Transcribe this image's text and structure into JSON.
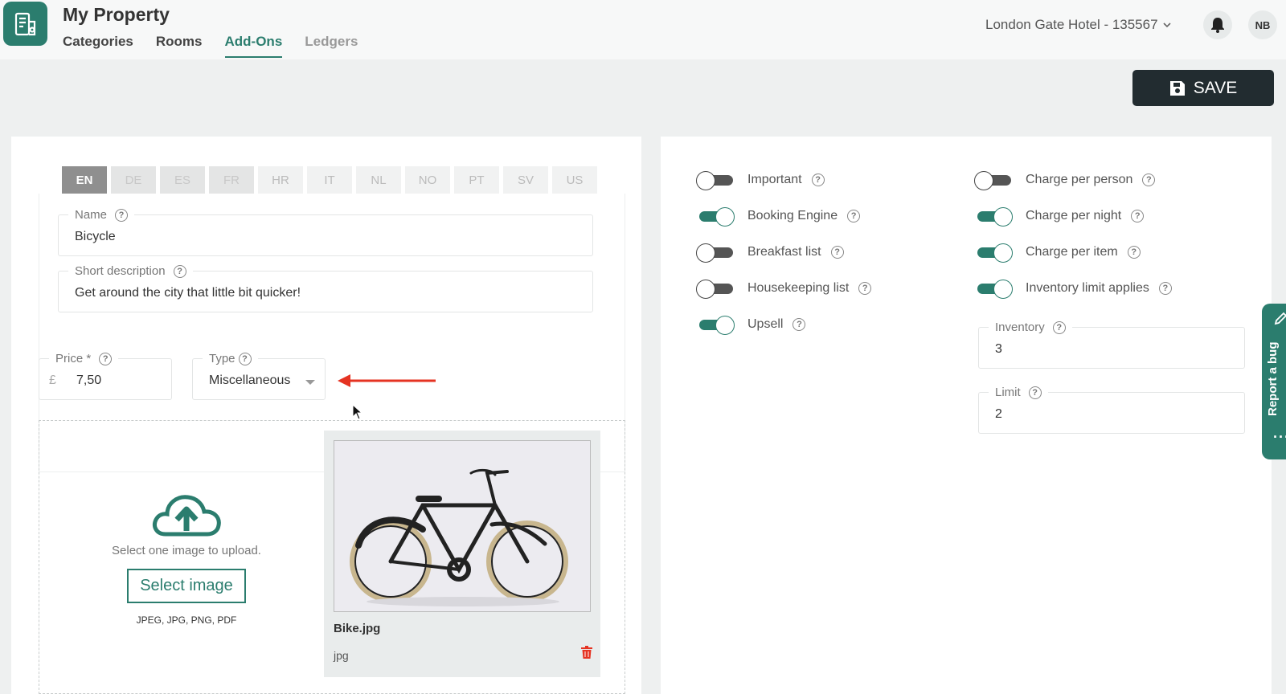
{
  "header": {
    "title": "My Property",
    "nav": [
      "Categories",
      "Rooms",
      "Add-Ons",
      "Ledgers"
    ],
    "hotel": "London Gate Hotel - 135567",
    "user_initials": "NB"
  },
  "toolbar": {
    "save_label": "SAVE"
  },
  "languages": [
    "EN",
    "DE",
    "ES",
    "FR",
    "HR",
    "IT",
    "NL",
    "NO",
    "PT",
    "SV",
    "US"
  ],
  "form": {
    "name_label": "Name",
    "name_value": "Bicycle",
    "short_desc_label": "Short description",
    "short_desc_value": "Get around the city that little bit quicker!",
    "price_label": "Price *",
    "currency": "£",
    "price_value": "7,50",
    "type_label": "Type",
    "type_value": "Miscellaneous"
  },
  "upload": {
    "prompt": "Select one image to upload.",
    "button": "Select image",
    "formats": "JPEG, JPG, PNG, PDF",
    "file_name": "Bike.jpg",
    "file_type": "jpg"
  },
  "toggles_left": [
    {
      "label": "Important",
      "on": false
    },
    {
      "label": "Booking Engine",
      "on": true
    },
    {
      "label": "Breakfast list",
      "on": false
    },
    {
      "label": "Housekeeping list",
      "on": false
    },
    {
      "label": "Upsell",
      "on": true
    }
  ],
  "toggles_right": [
    {
      "label": "Charge per person",
      "on": false
    },
    {
      "label": "Charge per night",
      "on": true
    },
    {
      "label": "Charge per item",
      "on": true
    },
    {
      "label": "Inventory limit applies",
      "on": true
    }
  ],
  "inventory": {
    "label": "Inventory",
    "value": "3"
  },
  "limit": {
    "label": "Limit",
    "value": "2"
  },
  "report": {
    "label": "Report a bug"
  },
  "colors": {
    "accent": "#2b7d6e",
    "dark": "#222c30",
    "arrow": "#e53322"
  }
}
